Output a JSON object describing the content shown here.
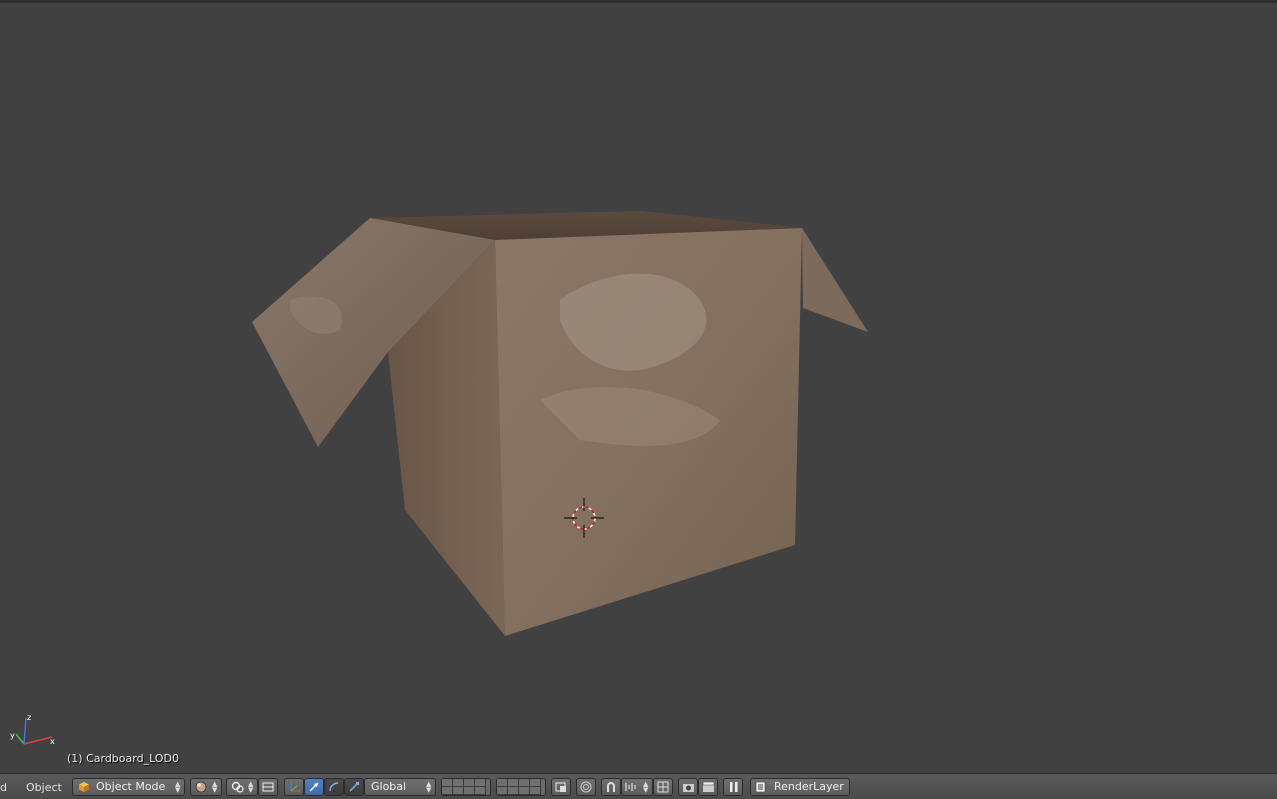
{
  "viewport": {
    "object_info": "(1) Cardboard_LOD0",
    "active_object": "Cardboard_LOD0",
    "background_color": "#414141"
  },
  "header": {
    "truncated_menu_label": "d",
    "object_menu_label": "Object",
    "mode_label": "Object Mode",
    "orientation_label": "Global",
    "render_layer_label": "RenderLayer",
    "icons": {
      "mode": "cube-icon",
      "shading": "sphere-shading-icon",
      "pivot": "pivot-point-icon",
      "manipulator_toggle": "manipulator-icon",
      "translate": "translate-arrow-icon",
      "rotate": "rotate-arc-icon",
      "scale": "scale-icon",
      "layers": "layer-grid-icon",
      "lock_layers": "lock-layers-icon",
      "proportional": "proportional-edit-icon",
      "snap": "snap-magnet-icon",
      "snap_element": "snap-element-icon",
      "snap_target": "snap-target-icon",
      "opengl_render": "camera-render-icon",
      "opengl_anim": "clapperboard-icon",
      "pause": "pause-icon",
      "render_layer": "render-layer-icon"
    }
  }
}
